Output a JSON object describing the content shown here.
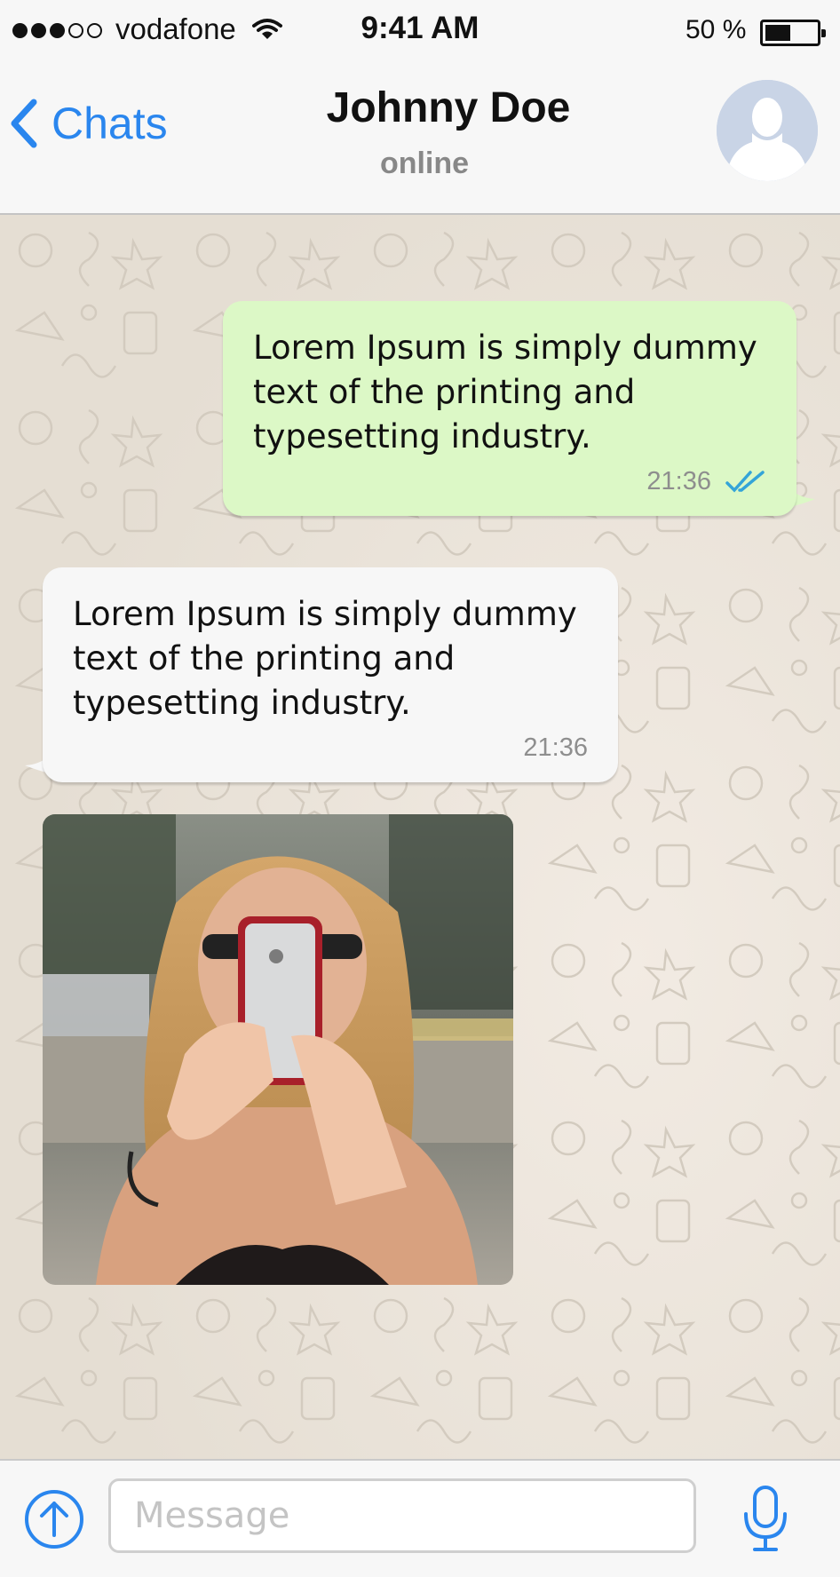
{
  "status_bar": {
    "carrier": "vodafone",
    "signal_bars_filled": 3,
    "signal_bars_total": 5,
    "time": "9:41 AM",
    "battery_percent_label": "50 %",
    "battery_level": 0.5
  },
  "nav": {
    "back_label": "Chats",
    "contact_name": "Johnny Doe",
    "presence": "online",
    "icons": {
      "back": "chevron-left-icon",
      "avatar": "default-user-avatar"
    }
  },
  "messages": [
    {
      "direction": "outgoing",
      "text": "Lorem Ipsum is simply dummy text of the printing and typesetting industry.",
      "time": "21:36",
      "status": "read"
    },
    {
      "direction": "incoming",
      "text": "Lorem Ipsum is simply dummy text of the printing and typesetting industry.",
      "time": "21:36"
    },
    {
      "direction": "incoming",
      "type": "image",
      "image": "woman-taking-photo-with-phone"
    }
  ],
  "composer": {
    "placeholder": "Message",
    "value": "",
    "icons": {
      "attach": "upload-arrow-icon",
      "mic": "microphone-icon"
    }
  },
  "colors": {
    "accent": "#2a86ee",
    "outgoing_bubble": "#dcf8c6",
    "incoming_bubble": "#f7f7f7",
    "chat_background": "#e9e2d8",
    "read_ticks": "#34a4d8"
  }
}
